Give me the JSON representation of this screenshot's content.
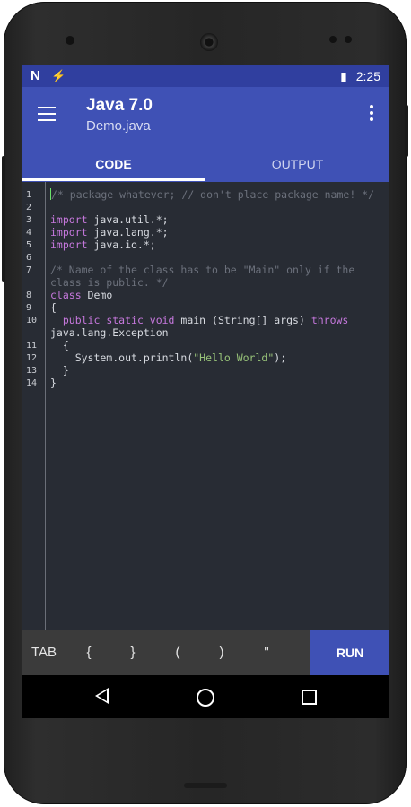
{
  "status_bar": {
    "left_icons": [
      "N",
      "⚡"
    ],
    "battery_icon": "▮",
    "time": "2:25"
  },
  "app_bar": {
    "title": "Java 7.0",
    "subtitle": "Demo.java"
  },
  "tabs": [
    {
      "label": "CODE",
      "selected": true
    },
    {
      "label": "OUTPUT",
      "selected": false
    }
  ],
  "editor": {
    "line_numbers": [
      "1",
      "2",
      "3",
      "4",
      "5",
      "6",
      "7",
      "8",
      "9",
      "10",
      "11",
      "12",
      "13",
      "14"
    ],
    "lines": [
      "/* package whatever; // don't place package name! */",
      "",
      "import java.util.*;",
      "import java.lang.*;",
      "import java.io.*;",
      "",
      "/* Name of the class has to be \"Main\" only if the",
      "class is public. */",
      "class Demo",
      "{",
      "  public static void main (String[] args) throws",
      "java.lang.Exception",
      "  {",
      "    System.out.println(\"Hello World\");",
      "  }",
      "}"
    ]
  },
  "keys": {
    "tab": "TAB",
    "brace_open": "{",
    "brace_close": "}",
    "paren_open": "(",
    "paren_close": ")",
    "quote": "\"",
    "run": "RUN"
  },
  "colors": {
    "primary": "#3f51b5",
    "primary_dark": "#303f9f",
    "editor_bg": "#282c34",
    "keyword": "#c678dd",
    "string": "#98c379",
    "comment": "#6c717c"
  }
}
